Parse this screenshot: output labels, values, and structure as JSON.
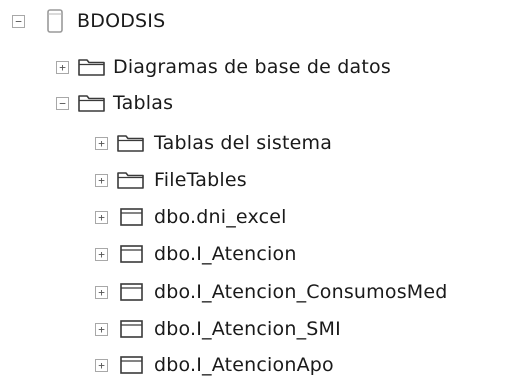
{
  "tree": {
    "root": {
      "label": "BDODSIS",
      "toggle": "−",
      "icon": "database-icon"
    },
    "diagramas": {
      "label": "Diagramas de base de datos",
      "toggle": "+",
      "icon": "folder-icon"
    },
    "tablas": {
      "label": "Tablas",
      "toggle": "−",
      "icon": "folder-icon"
    },
    "tablas_sistema": {
      "label": "Tablas del sistema",
      "toggle": "+",
      "icon": "folder-icon"
    },
    "filetables": {
      "label": "FileTables",
      "toggle": "+",
      "icon": "folder-icon"
    },
    "tables": [
      {
        "label": "dbo.dni_excel",
        "toggle": "+",
        "icon": "table-icon"
      },
      {
        "label": "dbo.I_Atencion",
        "toggle": "+",
        "icon": "table-icon"
      },
      {
        "label": "dbo.I_Atencion_ConsumosMed",
        "toggle": "+",
        "icon": "table-icon"
      },
      {
        "label": "dbo.I_Atencion_SMI",
        "toggle": "+",
        "icon": "table-icon"
      },
      {
        "label": "dbo.I_AtencionApo",
        "toggle": "+",
        "icon": "table-icon"
      }
    ]
  }
}
